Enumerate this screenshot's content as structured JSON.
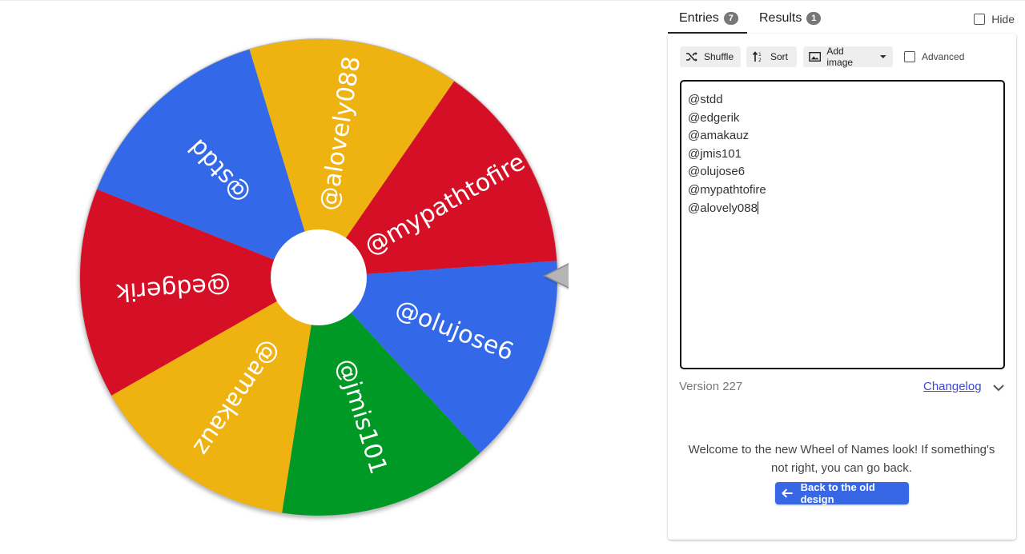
{
  "wheel": {
    "slices": [
      {
        "label": "@olujose6",
        "color": "#3369e8",
        "text_color": "#ffffff"
      },
      {
        "label": "@jmis101",
        "color": "#009925",
        "text_color": "#111111"
      },
      {
        "label": "@amakauz",
        "color": "#eeb211",
        "text_color": "#111111"
      },
      {
        "label": "@edgerik",
        "color": "#d50f25",
        "text_color": "#ffffff"
      },
      {
        "label": "@stdd",
        "color": "#3369e8",
        "text_color": "#ffffff"
      },
      {
        "label": "@alovely088",
        "color": "#eeb211",
        "text_color": "#111111"
      },
      {
        "label": "@mypathtofire",
        "color": "#d50f25",
        "text_color": "#ffffff"
      }
    ],
    "pointer_icon": "triangle-pointer-icon"
  },
  "tabs": [
    {
      "label": "Entries",
      "count": "7"
    },
    {
      "label": "Results",
      "count": "1"
    }
  ],
  "hide_label": "Hide",
  "toolbar": {
    "shuffle_label": "Shuffle",
    "sort_label": "Sort",
    "add_image_label": "Add image",
    "advanced_label": "Advanced"
  },
  "entries": [
    "@stdd",
    "@edgerik",
    "@amakauz",
    "@jmis101",
    "@olujose6",
    "@mypathtofire",
    "@alovely088"
  ],
  "version_label": "Version 227",
  "changelog_label": "Changelog",
  "welcome_text": "Welcome to the new Wheel of Names look! If something's not right, you can go back.",
  "back_button_label": "Back to the old design",
  "colors": {
    "accent": "#3867e6",
    "link": "#3b48d8"
  }
}
